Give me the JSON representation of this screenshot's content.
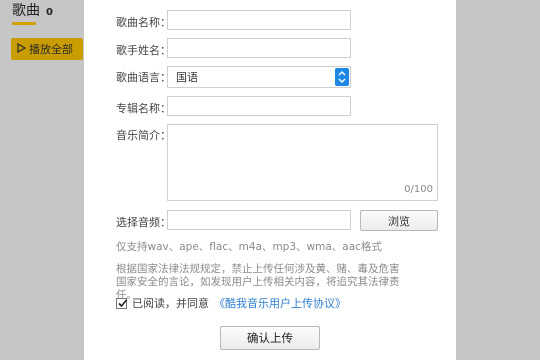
{
  "background": {
    "section_title": "歌曲",
    "section_count": "0",
    "play_all_label": "播放全部"
  },
  "form": {
    "song_name_label": "歌曲名称：",
    "singer_name_label": "歌手姓名：",
    "language_label": "歌曲语言：",
    "language_value": "国语",
    "album_name_label": "专辑名称：",
    "intro_label": "音乐简介：",
    "intro_counter": "0/100",
    "select_file_label": "选择音频：",
    "browse_label": "浏览",
    "formats_text": "仅支持wav、ape、flac、m4a、mp3、wma、aac格式",
    "notice_text": "根据国家法律法规规定，禁止上传任何涉及黄、赌、毒及危害国家安全的言论，如发现用户上传相关内容，将追究其法律责任。",
    "agree_text": "已阅读，并同意",
    "agree_link": "《酷我音乐用户上传协议》",
    "agree_checked": true,
    "confirm_label": "确认上传"
  },
  "colors": {
    "accent_yellow": "#c99d00",
    "select_arrow_blue": "#1e88e5",
    "link_blue": "#2f7fd0"
  }
}
